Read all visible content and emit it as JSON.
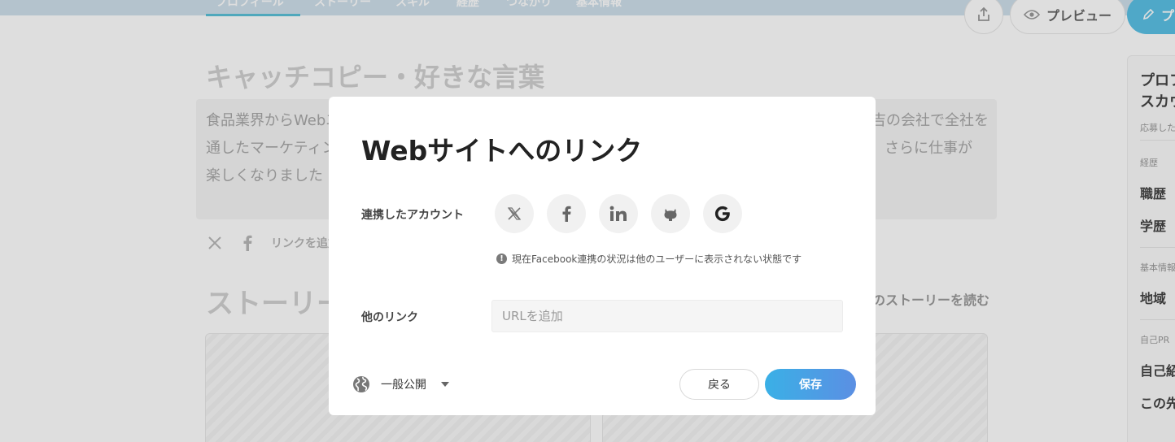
{
  "background": {
    "nav_tabs": [
      "プロフィール",
      "ストーリー",
      "スキル",
      "経歴",
      "つながり",
      "基本情報"
    ],
    "preview_label": "プレビュー",
    "publish_label": "プ",
    "catch_title": "キャッチコピー・好きな言葉",
    "catch_lines": [
      "食品業界からWebエ",
      "通したマーケティン",
      "楽しくなりました"
    ],
    "catch_right_lines": [
      "吉の会社で全社を",
      "さらに仕事が"
    ],
    "add_link_label": "リンクを追加",
    "story_title": "ストーリー",
    "story_read_link": "のストーリーを読む",
    "right_panel": {
      "title_lines": [
        "プロフ",
        "スカウ"
      ],
      "subtitle": "応募した",
      "section_career": "経歴",
      "item_job": "職歴",
      "item_school": "学歴",
      "section_basic": "基本情報",
      "item_region": "地域",
      "section_pr": "自己PR",
      "item_pr": "自己紹",
      "item_future": "この先"
    }
  },
  "modal": {
    "title": "Webサイトへのリンク",
    "accounts_label": "連携したアカウント",
    "account_icons": [
      "x-icon",
      "facebook-icon",
      "linkedin-icon",
      "github-icon",
      "google-icon"
    ],
    "notice": "現在Facebook連携の状況は他のユーザーに表示されない状態です",
    "other_links_label": "他のリンク",
    "url_placeholder": "URLを追加",
    "url_value": "",
    "visibility_label": "一般公開",
    "back_label": "戻る",
    "save_label": "保存"
  },
  "colors": {
    "accent": "#3ab0e6",
    "nav_bg": "#cfe1ec",
    "overlay": "rgba(0,0,0,0.13)"
  }
}
